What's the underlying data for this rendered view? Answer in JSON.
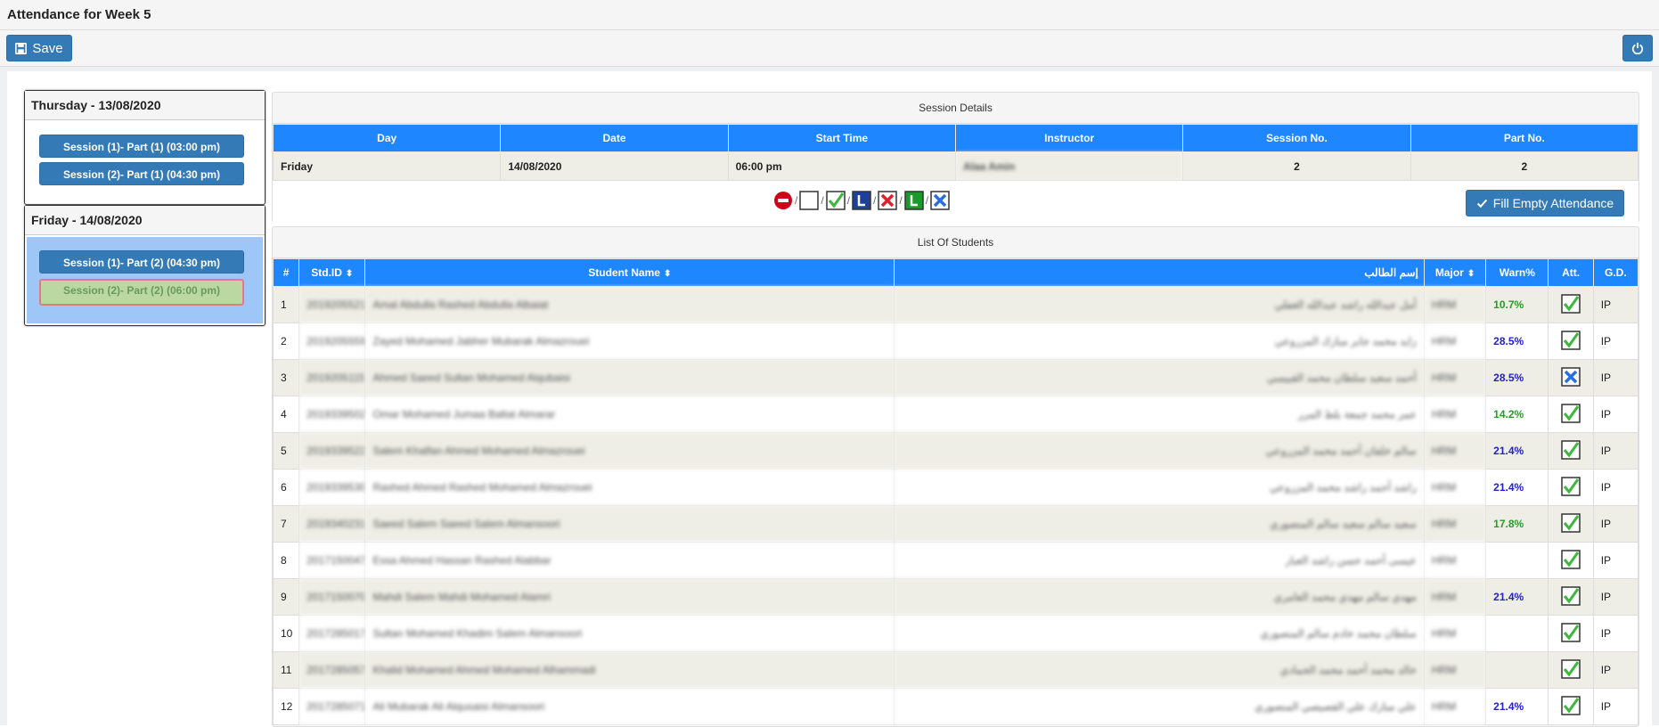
{
  "window": {
    "title": "Attendance for Week 5"
  },
  "toolbar": {
    "save_label": "Save",
    "power_icon": "power-icon"
  },
  "days": [
    {
      "label": "Thursday - 13/08/2020",
      "sessions": [
        "Session (1)- Part (1) (03:00 pm)",
        "Session (2)- Part (1) (04:30 pm)"
      ]
    },
    {
      "label": "Friday - 14/08/2020",
      "sessions": [
        "Session (1)- Part (2) (04:30 pm)",
        "Session (2)- Part (2) (06:00 pm)"
      ],
      "active_index": 1
    }
  ],
  "session_details": {
    "title": "Session Details",
    "headers": [
      "Day",
      "Date",
      "Start Time",
      "Instructor",
      "Session No.",
      "Part No."
    ],
    "values": [
      "Friday",
      "14/08/2020",
      "06:00 pm",
      "Alaa Amin",
      "2",
      "2"
    ]
  },
  "legend": {
    "separator": "/",
    "icons": [
      "remove-icon",
      "empty-box-icon",
      "present-check-icon",
      "late-blue-icon",
      "absent-red-x-icon",
      "late-green-icon",
      "excused-blue-x-icon"
    ]
  },
  "fill_button": {
    "label": "Fill Empty Attendance"
  },
  "students_panel": {
    "title": "List Of Students",
    "headers": {
      "num": "#",
      "std_id": "Std.ID",
      "name": "Student Name",
      "arabic_name": "إسم الطالب",
      "major": "Major",
      "warn": "Warn%",
      "att": "Att.",
      "gd": "G.D."
    },
    "rows": [
      {
        "num": "1",
        "id": "2019205521",
        "name": "Amal Abdulla Rashed Abdulla Albaiat",
        "arabic": "أمل عبدالله راشد عبدالله الغفلي",
        "major": "HRM",
        "warn": "10.7%",
        "warn_color": "green",
        "att": "present",
        "gd": "IP"
      },
      {
        "num": "2",
        "id": "2019205559",
        "name": "Zayed Mohamed Jabher Mubarak Almazrouei",
        "arabic": "زايد محمد جابر مبارك المزروعي",
        "major": "HRM",
        "warn": "28.5%",
        "warn_color": "blue",
        "att": "present",
        "gd": "IP"
      },
      {
        "num": "3",
        "id": "2019205115",
        "name": "Ahmed Saeed Sultan Mohamed Alqubaisi",
        "arabic": "أحمد سعيد سلطان محمد القبيسي",
        "major": "HRM",
        "warn": "28.5%",
        "warn_color": "blue",
        "att": "excused",
        "gd": "IP"
      },
      {
        "num": "4",
        "id": "2019339502",
        "name": "Omar Mohamed Jumaa Baltat Almarar",
        "arabic": "عمر محمد جمعة بلط المرر",
        "major": "HRM",
        "warn": "14.2%",
        "warn_color": "green",
        "att": "present",
        "gd": "IP"
      },
      {
        "num": "5",
        "id": "2019339522",
        "name": "Salem Khalfan Ahmed Mohamed Almazrouei",
        "arabic": "سالم خلفان أحمد محمد المزروعي",
        "major": "HRM",
        "warn": "21.4%",
        "warn_color": "blue",
        "att": "present",
        "gd": "IP"
      },
      {
        "num": "6",
        "id": "2019339530",
        "name": "Rashed Ahmed Rashed Mohamed Almazrouei",
        "arabic": "راشد أحمد راشد محمد المزروعي",
        "major": "HRM",
        "warn": "21.4%",
        "warn_color": "blue",
        "att": "present",
        "gd": "IP"
      },
      {
        "num": "7",
        "id": "2019340231",
        "name": "Saeed Salem Saeed Salem Almansoori",
        "arabic": "سعيد سالم سعيد سالم المنصوري",
        "major": "HRM",
        "warn": "17.8%",
        "warn_color": "green",
        "att": "present",
        "gd": "IP"
      },
      {
        "num": "8",
        "id": "2017150047",
        "name": "Essa Ahmed Hassan Rashed Alabbar",
        "arabic": "عيسى أحمد حسن راشد العبار",
        "major": "HRM",
        "warn": "",
        "warn_color": "blue",
        "att": "present",
        "gd": "IP"
      },
      {
        "num": "9",
        "id": "2017150070",
        "name": "Mahdi Salem Mahdi Mohamed Alamri",
        "arabic": "مهدي سالم مهدي محمد العامري",
        "major": "HRM",
        "warn": "21.4%",
        "warn_color": "blue",
        "att": "present",
        "gd": "IP"
      },
      {
        "num": "10",
        "id": "2017285017",
        "name": "Sultan Mohamed Khadim Salem Almansoori",
        "arabic": "سلطان محمد خادم سالم المنصوري",
        "major": "HRM",
        "warn": "",
        "warn_color": "blue",
        "att": "present",
        "gd": "IP"
      },
      {
        "num": "11",
        "id": "2017285057",
        "name": "Khalid Mohamed Ahmed Mohamed Alhammadi",
        "arabic": "خالد محمد أحمد محمد الحمادي",
        "major": "HRM",
        "warn": "",
        "warn_color": "blue",
        "att": "present",
        "gd": "IP"
      },
      {
        "num": "12",
        "id": "2017285071",
        "name": "Ali Mubarak Ali Alqusaisi Almansoori",
        "arabic": "علي مبارك علي القصيصي المنصوري",
        "major": "HRM",
        "warn": "21.4%",
        "warn_color": "blue",
        "att": "present",
        "gd": "IP"
      }
    ]
  },
  "colors": {
    "header_blue": "#1e86ff",
    "button_blue": "#337ab7",
    "warn_green": "#2a9a2a",
    "warn_blue": "#2323c8",
    "active_session": "#bbd8a3"
  }
}
